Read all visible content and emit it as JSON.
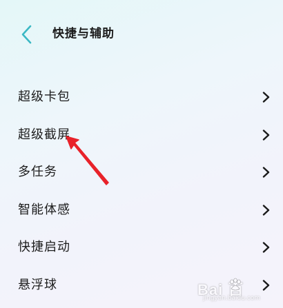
{
  "header": {
    "title": "快捷与辅助",
    "back_icon": "chevron-left-icon",
    "accent_color": "#3bb8c4"
  },
  "list": {
    "items": [
      {
        "label": "超级卡包",
        "icon": "chevron-right-icon"
      },
      {
        "label": "超级截屏",
        "icon": "chevron-right-icon"
      },
      {
        "label": "多任务",
        "icon": "chevron-right-icon"
      },
      {
        "label": "智能体感",
        "icon": "chevron-right-icon"
      },
      {
        "label": "快捷启动",
        "icon": "chevron-right-icon"
      },
      {
        "label": "悬浮球",
        "icon": "chevron-right-icon"
      }
    ]
  },
  "annotation": {
    "color": "#e8222a"
  },
  "watermark": {
    "brand": "Bai 百",
    "sub": "jingyan.baidu.com"
  }
}
